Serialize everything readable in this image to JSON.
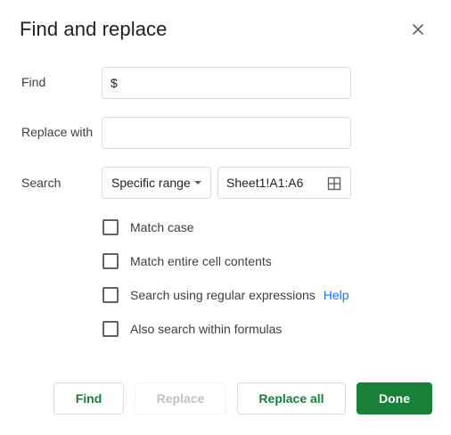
{
  "dialog": {
    "title": "Find and replace",
    "close_icon": "close-icon"
  },
  "find": {
    "label": "Find",
    "value": "$"
  },
  "replace": {
    "label": "Replace with",
    "value": ""
  },
  "search": {
    "label": "Search",
    "scope": "Specific range",
    "range": "Sheet1!A1:A6",
    "range_icon": "grid-icon"
  },
  "options": [
    {
      "label": "Match case",
      "checked": false
    },
    {
      "label": "Match entire cell contents",
      "checked": false
    },
    {
      "label": "Search using regular expressions",
      "checked": false,
      "link": "Help"
    },
    {
      "label": "Also search within formulas",
      "checked": false
    }
  ],
  "buttons": {
    "find": "Find",
    "replace": "Replace",
    "replace_all": "Replace all",
    "done": "Done"
  },
  "colors": {
    "accent_green": "#188038",
    "link_blue": "#1a73e8",
    "disabled_text": "#bdc1c6"
  }
}
